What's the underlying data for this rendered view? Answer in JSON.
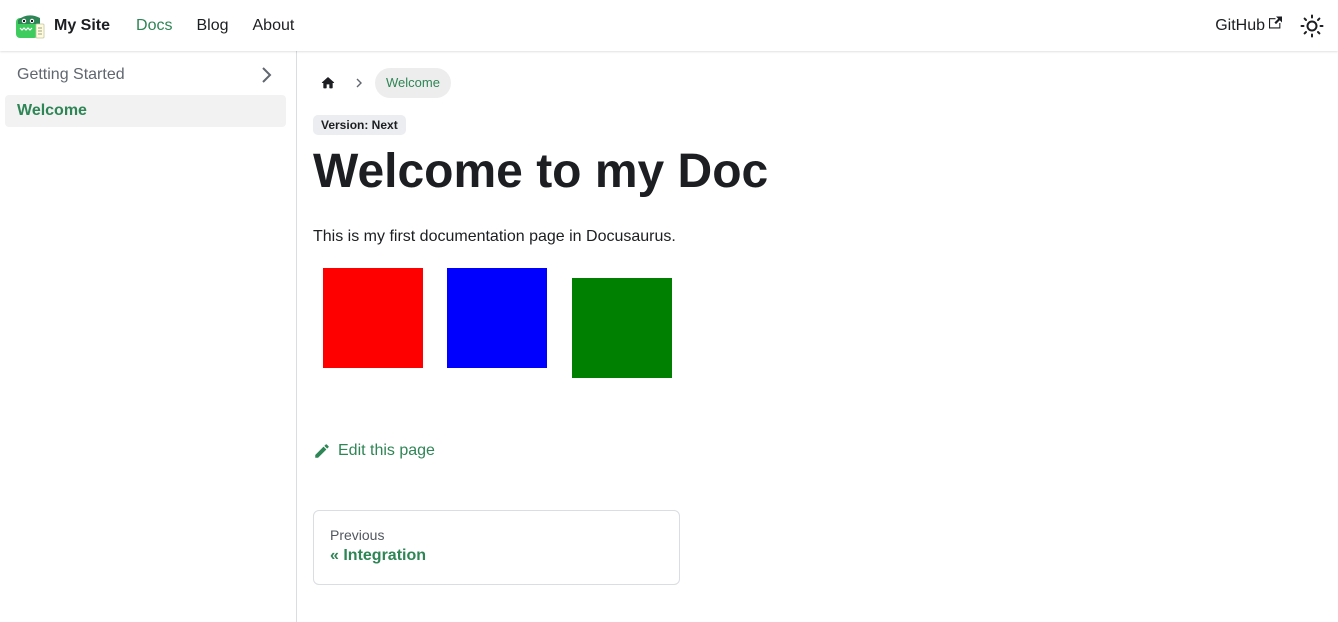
{
  "navbar": {
    "brand_title": "My Site",
    "links": [
      {
        "label": "Docs",
        "active": true
      },
      {
        "label": "Blog",
        "active": false
      },
      {
        "label": "About",
        "active": false
      }
    ],
    "github_label": "GitHub",
    "theme_toggle_icon": "sun-icon"
  },
  "sidebar": {
    "category_label": "Getting Started",
    "active_item_label": "Welcome"
  },
  "main": {
    "breadcrumb_current": "Welcome",
    "version_badge": "Version: Next",
    "title": "Welcome to my Doc",
    "paragraph": "This is my first documentation page in Docusaurus.",
    "squares": [
      {
        "color": "#ff0000"
      },
      {
        "color": "#0000ff"
      },
      {
        "color": "#008000"
      }
    ],
    "edit_label": "Edit this page",
    "pager": {
      "sublabel": "Previous",
      "label": "« Integration"
    }
  },
  "colors": {
    "accent": "#2e8555",
    "text": "#1c1e21",
    "muted": "#606770"
  }
}
